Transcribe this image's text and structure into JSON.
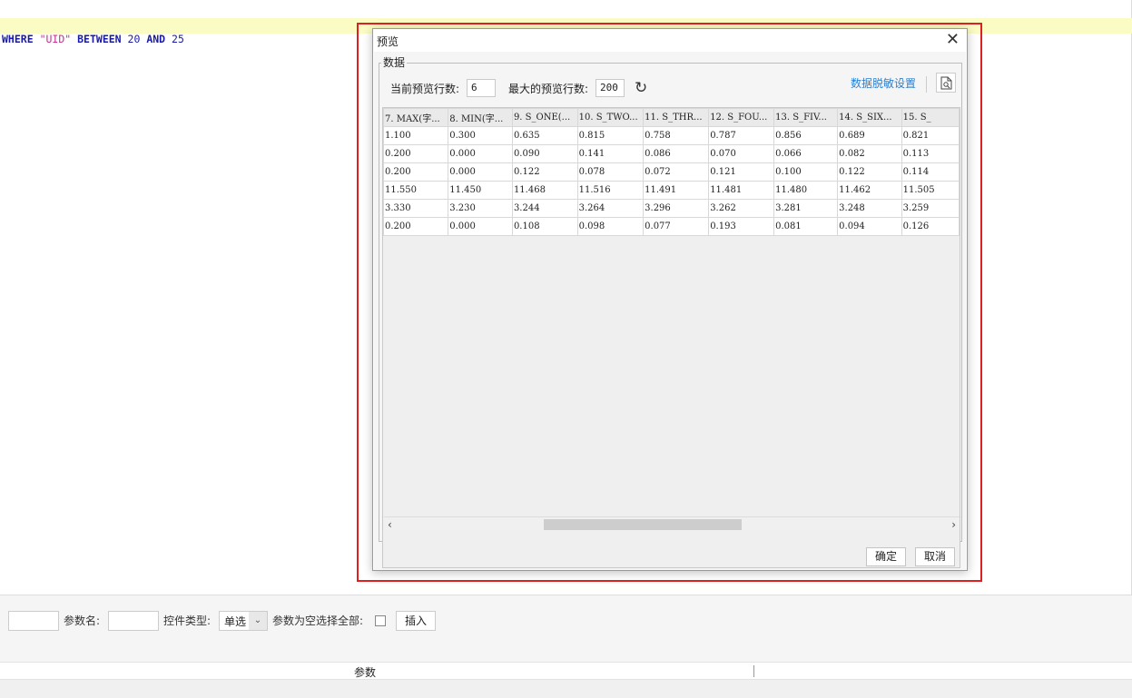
{
  "editor": {
    "sql": {
      "kw1": "WHERE",
      "str": "\"UID\"",
      "kw2": "BETWEEN",
      "n1": "20",
      "kw3": "AND",
      "n2": "25"
    }
  },
  "param_bar": {
    "param_name_label": "参数名:",
    "control_type_label": "控件类型:",
    "control_type_value": "单选",
    "select_all_label": "参数为空选择全部:",
    "insert_button": "插入",
    "header_param": "参数"
  },
  "dialog": {
    "title": "预览",
    "group_label": "数据",
    "current_rows_label": "当前预览行数:",
    "current_rows_value": "6",
    "max_rows_label": "最大的预览行数:",
    "max_rows_value": "200",
    "masking_link": "数据脱敏设置",
    "ok_button": "确定",
    "cancel_button": "取消",
    "columns": [
      "7. MAX(字...",
      "8. MIN(字...",
      "9. S_ONE(...",
      "10. S_TWO...",
      "11. S_THR...",
      "12. S_FOU...",
      "13. S_FIV...",
      "14. S_SIX...",
      "15. S_"
    ],
    "rows": [
      [
        "1.100",
        "0.300",
        "0.635",
        "0.815",
        "0.758",
        "0.787",
        "0.856",
        "0.689",
        "0.821"
      ],
      [
        "0.200",
        "0.000",
        "0.090",
        "0.141",
        "0.086",
        "0.070",
        "0.066",
        "0.082",
        "0.113"
      ],
      [
        "0.200",
        "0.000",
        "0.122",
        "0.078",
        "0.072",
        "0.121",
        "0.100",
        "0.122",
        "0.114"
      ],
      [
        "11.550",
        "11.450",
        "11.468",
        "11.516",
        "11.491",
        "11.481",
        "11.480",
        "11.462",
        "11.505"
      ],
      [
        "3.330",
        "3.230",
        "3.244",
        "3.264",
        "3.296",
        "3.262",
        "3.281",
        "3.248",
        "3.259"
      ],
      [
        "0.200",
        "0.000",
        "0.108",
        "0.098",
        "0.077",
        "0.193",
        "0.081",
        "0.094",
        "0.126"
      ]
    ]
  }
}
